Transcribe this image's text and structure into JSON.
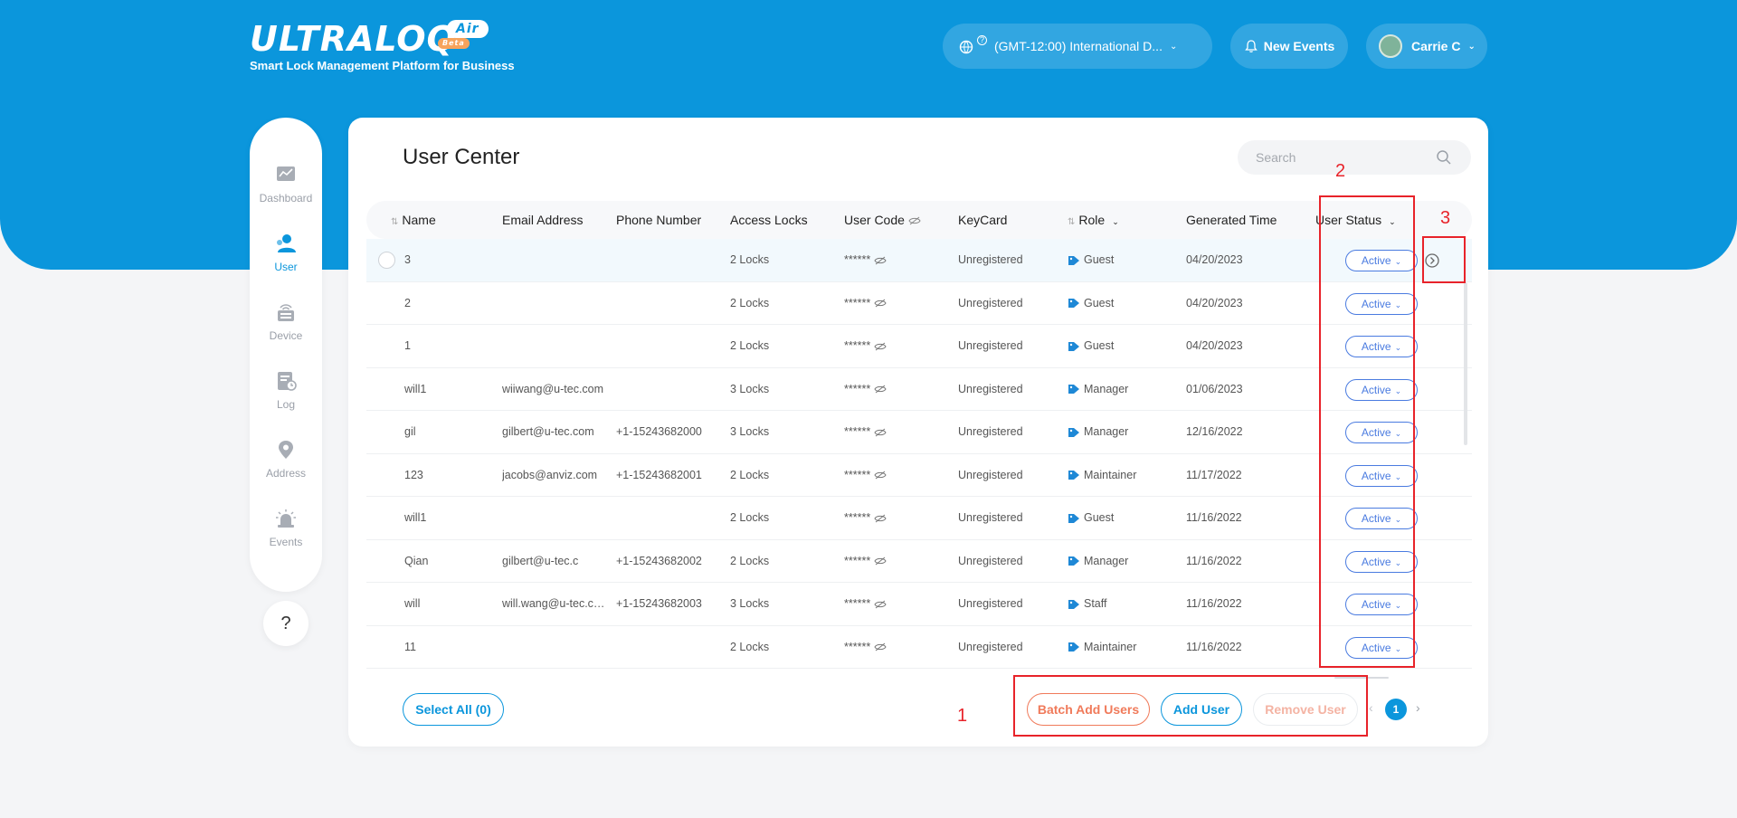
{
  "brand": {
    "logo": "ULTRALOQ",
    "air": "Air",
    "beta": "Beta",
    "tagline": "Smart Lock Management Platform for Business"
  },
  "header": {
    "timezone": "(GMT-12:00) International D...",
    "timezone_help": "?",
    "new_events": "New Events",
    "user_name": "Carrie C"
  },
  "sidebar": {
    "items": [
      {
        "label": "Dashboard",
        "icon": "dashboard-icon"
      },
      {
        "label": "User",
        "icon": "user-icon"
      },
      {
        "label": "Device",
        "icon": "device-icon"
      },
      {
        "label": "Log",
        "icon": "log-icon"
      },
      {
        "label": "Address",
        "icon": "location-pin-icon"
      },
      {
        "label": "Events",
        "icon": "alarm-icon"
      }
    ],
    "active": "User",
    "help": "?"
  },
  "main": {
    "title": "User Center",
    "search_placeholder": "Search",
    "columns": [
      "Name",
      "Email Address",
      "Phone Number",
      "Access Locks",
      "User Code",
      "KeyCard",
      "Role",
      "Generated Time",
      "User Status"
    ],
    "rows": [
      {
        "name": "3",
        "email": "",
        "phone": "",
        "locks": "2 Locks",
        "code": "******",
        "keycard": "Unregistered",
        "role": "Guest",
        "time": "04/20/2023",
        "status": "Active"
      },
      {
        "name": "2",
        "email": "",
        "phone": "",
        "locks": "2 Locks",
        "code": "******",
        "keycard": "Unregistered",
        "role": "Guest",
        "time": "04/20/2023",
        "status": "Active"
      },
      {
        "name": "1",
        "email": "",
        "phone": "",
        "locks": "2 Locks",
        "code": "******",
        "keycard": "Unregistered",
        "role": "Guest",
        "time": "04/20/2023",
        "status": "Active"
      },
      {
        "name": "will1",
        "email": "wiiwang@u-tec.com",
        "phone": "",
        "locks": "3 Locks",
        "code": "******",
        "keycard": "Unregistered",
        "role": "Manager",
        "time": "01/06/2023",
        "status": "Active"
      },
      {
        "name": "gil",
        "email": "gilbert@u-tec.com",
        "phone": "+1-15243682000",
        "locks": "3 Locks",
        "code": "******",
        "keycard": "Unregistered",
        "role": "Manager",
        "time": "12/16/2022",
        "status": "Active"
      },
      {
        "name": "123",
        "email": "jacobs@anviz.com",
        "phone": "+1-15243682001",
        "locks": "2 Locks",
        "code": "******",
        "keycard": "Unregistered",
        "role": "Maintainer",
        "time": "11/17/2022",
        "status": "Active"
      },
      {
        "name": "will1",
        "email": "",
        "phone": "",
        "locks": "2 Locks",
        "code": "******",
        "keycard": "Unregistered",
        "role": "Guest",
        "time": "11/16/2022",
        "status": "Active"
      },
      {
        "name": "Qian",
        "email": "gilbert@u-tec.c",
        "phone": "+1-15243682002",
        "locks": "2 Locks",
        "code": "******",
        "keycard": "Unregistered",
        "role": "Manager",
        "time": "11/16/2022",
        "status": "Active"
      },
      {
        "name": "will",
        "email": "will.wang@u-tec.co...",
        "phone": "+1-15243682003",
        "locks": "3 Locks",
        "code": "******",
        "keycard": "Unregistered",
        "role": "Staff",
        "time": "11/16/2022",
        "status": "Active"
      },
      {
        "name": "11",
        "email": "",
        "phone": "",
        "locks": "2 Locks",
        "code": "******",
        "keycard": "Unregistered",
        "role": "Maintainer",
        "time": "11/16/2022",
        "status": "Active"
      }
    ],
    "select_all": "Select All (0)",
    "batch_add": "Batch Add Users",
    "add_user": "Add User",
    "remove_user": "Remove User",
    "page": "1",
    "prev": "‹",
    "next": "›"
  },
  "annotations": [
    "1",
    "2",
    "3"
  ],
  "colors": {
    "brand_blue": "#0b96dc",
    "status_blue": "#4a7be0",
    "batch_orange": "#f07a5a",
    "annotation_red": "#e8232a"
  }
}
